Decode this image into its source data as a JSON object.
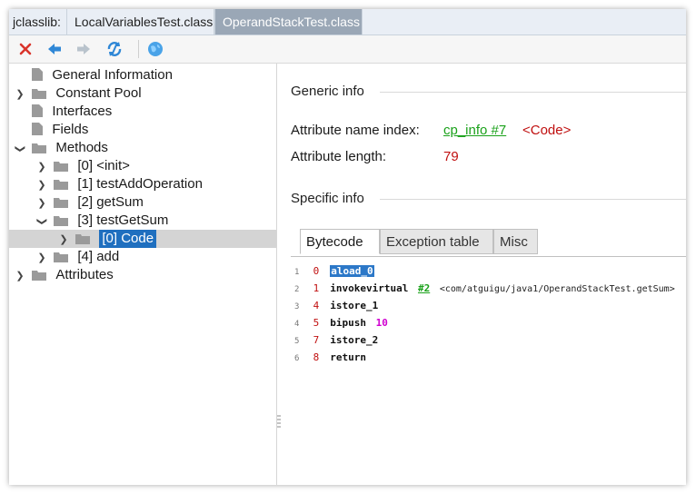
{
  "tabbar": {
    "prefix": "jclasslib:",
    "tabs": [
      {
        "label": "LocalVariablesTest.class"
      },
      {
        "label": "OperandStackTest.class"
      }
    ]
  },
  "toolbar": {
    "buttons": [
      "close-icon",
      "back-icon",
      "forward-icon",
      "refresh-icon",
      "web-icon"
    ]
  },
  "tree": {
    "items": [
      {
        "label": "General Information"
      },
      {
        "label": "Constant Pool"
      },
      {
        "label": "Interfaces"
      },
      {
        "label": "Fields"
      },
      {
        "label": "Methods"
      },
      {
        "label": "[0] <init>"
      },
      {
        "label": "[1] testAddOperation"
      },
      {
        "label": "[2] getSum"
      },
      {
        "label": "[3] testGetSum"
      },
      {
        "label": "[0] Code"
      },
      {
        "label": "[4] add"
      },
      {
        "label": "Attributes"
      }
    ]
  },
  "generic": {
    "title": "Generic info",
    "name_index_label": "Attribute name index:",
    "name_index_link": "cp_info #7",
    "name_index_value": "<Code>",
    "length_label": "Attribute length:",
    "length_value": "79"
  },
  "specific": {
    "title": "Specific info",
    "tabs": [
      "Bytecode",
      "Exception table",
      "Misc"
    ]
  },
  "bytecode": [
    {
      "line": "1",
      "offset": "0",
      "op": "aload_0"
    },
    {
      "line": "2",
      "offset": "1",
      "op": "invokevirtual",
      "ref": "#2",
      "comment": "<com/atguigu/java1/OperandStackTest.getSum>"
    },
    {
      "line": "3",
      "offset": "4",
      "op": "istore_1"
    },
    {
      "line": "4",
      "offset": "5",
      "op": "bipush",
      "arg": "10"
    },
    {
      "line": "5",
      "offset": "7",
      "op": "istore_2"
    },
    {
      "line": "6",
      "offset": "8",
      "op": "return"
    }
  ]
}
